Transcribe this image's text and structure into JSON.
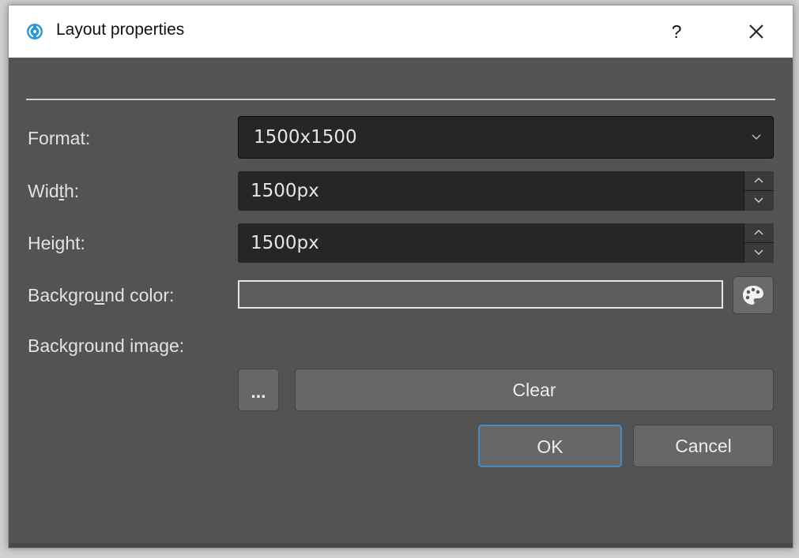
{
  "window": {
    "title": "Layout properties",
    "help_label": "?",
    "accent_color": "#4a8cc8"
  },
  "form": {
    "format": {
      "label": "Format:",
      "value": "1500x1500"
    },
    "width": {
      "label_pre": "Wid",
      "label_key": "t",
      "label_post": "h:",
      "value": "1500px"
    },
    "height": {
      "label_pre": "Hei",
      "label_key": "g",
      "label_post": "ht:",
      "value": "1500px"
    },
    "background_color": {
      "label_pre": "Backgro",
      "label_key": "u",
      "label_post": "nd color:",
      "value_color": "#5e5e5e"
    },
    "background_image": {
      "label": "Background image:",
      "browse_label": "...",
      "clear_label": "Clear"
    }
  },
  "buttons": {
    "ok_label": "OK",
    "cancel_label": "Cancel"
  },
  "icons": {
    "app": "app-logo-icon",
    "close": "close-icon",
    "palette": "palette-icon",
    "dropdown": "chevron-down-icon",
    "spin_up": "chevron-up-icon",
    "spin_down": "chevron-down-icon"
  }
}
